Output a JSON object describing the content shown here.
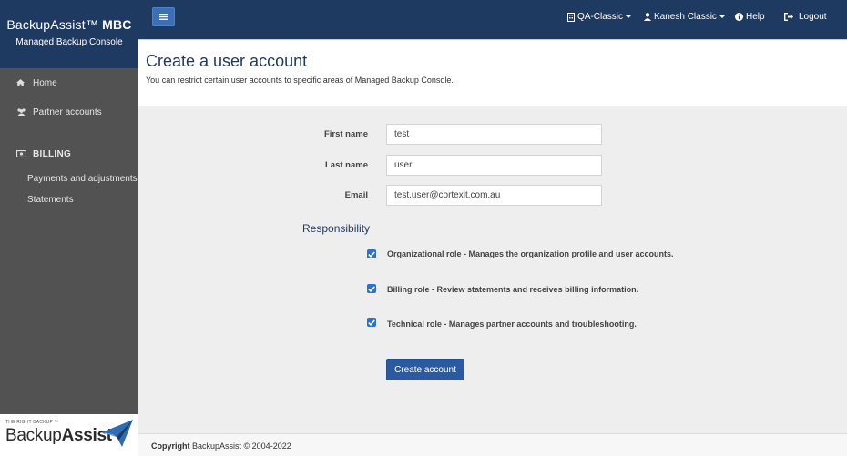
{
  "brand": {
    "name": "BackupAssist™",
    "name_bold": "MBC",
    "subtitle": "Managed Backup Console"
  },
  "sidebar": {
    "items": [
      {
        "label": "Home",
        "icon": "home-icon"
      },
      {
        "label": "Partner accounts",
        "icon": "users-icon"
      }
    ],
    "billing": {
      "label": "BILLING",
      "icon": "money-icon",
      "items": [
        {
          "label": "Payments and adjustments"
        },
        {
          "label": "Statements"
        }
      ]
    },
    "logo": {
      "tagline": "THE RIGHT BACKUP ™",
      "word_light": "Backup",
      "word_bold": "Assist"
    }
  },
  "topbar": {
    "menu_icon": "hamburger-icon",
    "org": "QA-Classic",
    "user": "Kanesh Classic",
    "help": "Help",
    "logout": "Logout"
  },
  "page": {
    "title": "Create a user account",
    "description": "You can restrict certain user accounts to specific areas of Managed Backup Console."
  },
  "form": {
    "first_name": {
      "label": "First name",
      "value": "test"
    },
    "last_name": {
      "label": "Last name",
      "value": "user"
    },
    "email": {
      "label": "Email",
      "value": "test.user@cortexit.com.au"
    },
    "responsibility": {
      "title": "Responsibility",
      "roles": [
        {
          "label": "Organizational role - Manages the organization profile and user accounts.",
          "checked": true
        },
        {
          "label": "Billing role - Review statements and receives billing information.",
          "checked": true
        },
        {
          "label": "Technical role - Manages partner accounts and troubleshooting.",
          "checked": true
        }
      ]
    },
    "submit_label": "Create account"
  },
  "footer": {
    "copyright_label": "Copyright",
    "copyright_text": "BackupAssist © 2004-2022"
  },
  "colors": {
    "navy": "#1f3a60",
    "sidebar": "#525252",
    "accent": "#2c5aa0",
    "checkbox": "#2f6fd0"
  }
}
